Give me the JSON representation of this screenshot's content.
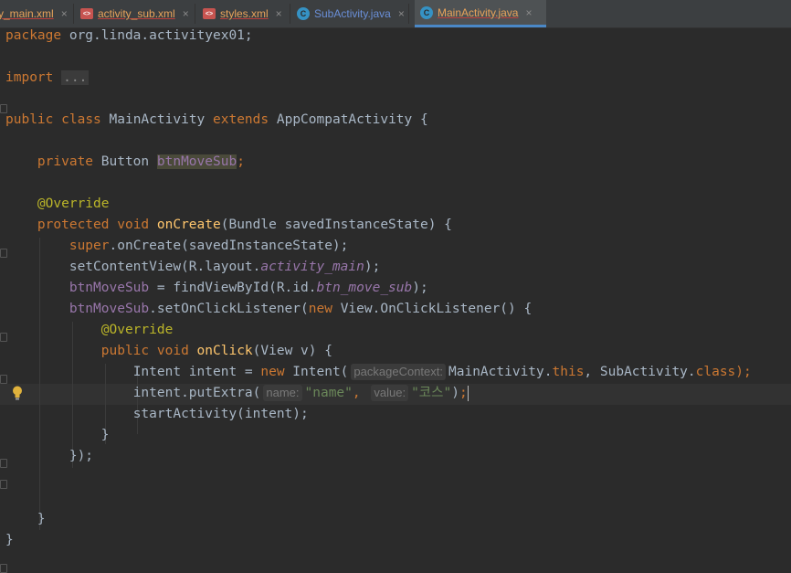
{
  "tabs": [
    {
      "label": "y_main.xml",
      "type": "xml",
      "active": false
    },
    {
      "label": "activity_sub.xml",
      "type": "xml",
      "active": false
    },
    {
      "label": "styles.xml",
      "type": "xml",
      "active": false
    },
    {
      "label": "SubActivity.java",
      "type": "java",
      "active": false
    },
    {
      "label": "MainActivity.java",
      "type": "java",
      "active": true
    }
  ],
  "tab_close_glyph": "×",
  "java_icon_letter": "C",
  "xml_icon_letter": "<>",
  "code": {
    "package_kw": "package",
    "package_name": "org.linda.activityex01;",
    "import_kw": "import",
    "import_fold": "...",
    "public": "public",
    "class": "class",
    "class_name": "MainActivity",
    "extends": "extends",
    "super_class": "AppCompatActivity {",
    "private": "private",
    "button_type": "Button",
    "field_name": "btnMoveSub",
    "semicolon": ";",
    "override": "@Override",
    "protected": "protected",
    "void": "void",
    "oncreate": "onCreate",
    "oncreate_params": "(Bundle savedInstanceState) {",
    "super": "super",
    "super_call": ".onCreate(savedInstanceState);",
    "setcontent": "setContentView(R.layout.",
    "activity_main": "activity_main",
    "close_call": ");",
    "field_assign": " = findViewById(R.id.",
    "btn_move_sub": "btn_move_sub",
    "set_listener": ".setOnClickListener(",
    "new": "new",
    "listener_type": " View.OnClickListener() {",
    "onclick": "onClick",
    "onclick_params": "(View v) {",
    "intent_decl": "Intent intent = ",
    "intent_ctor": " Intent(",
    "hint_package_context": "packageContext:",
    "main_activity": "MainActivity.",
    "this": "this",
    "comma_sub": ", SubActivity.",
    "class_kw": "class",
    "put_extra": "intent.putExtra(",
    "hint_name": "name:",
    "str_name": "\"name\"",
    "comma": ",",
    "hint_value": "value:",
    "str_value": "\"코스\"",
    "close_paren": ")",
    "start_activity": "startActivity(intent);",
    "brace_close": "}",
    "listener_close": "});"
  }
}
